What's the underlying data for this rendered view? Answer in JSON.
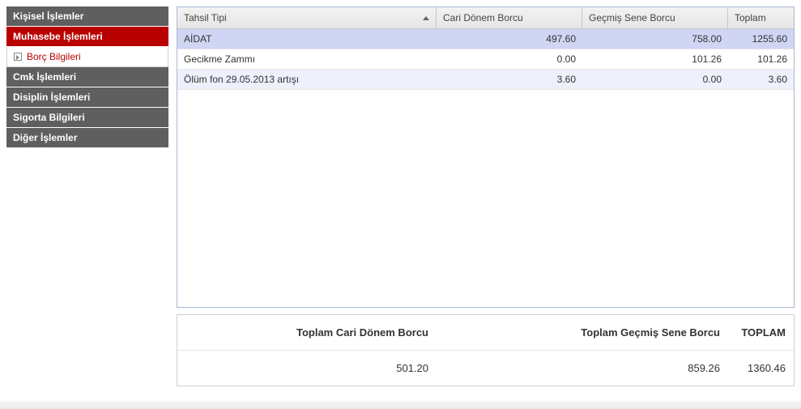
{
  "sidebar": {
    "items": [
      {
        "label": "Kişisel İşlemler",
        "active": false
      },
      {
        "label": "Muhasebe İşlemleri",
        "active": true
      },
      {
        "label": "Cmk İşlemleri",
        "active": false
      },
      {
        "label": "Disiplin İşlemleri",
        "active": false
      },
      {
        "label": "Sigorta Bilgileri",
        "active": false
      },
      {
        "label": "Diğer İşlemler",
        "active": false
      }
    ],
    "subitem": {
      "label": "Borç Bilgileri"
    }
  },
  "grid": {
    "headers": {
      "type": "Tahsil Tipi",
      "cari": "Cari Dönem Borcu",
      "gecmis": "Geçmiş Sene Borcu",
      "toplam": "Toplam"
    },
    "rows": [
      {
        "type": "AİDAT",
        "cari": "497.60",
        "gecmis": "758.00",
        "toplam": "1255.60",
        "selected": true
      },
      {
        "type": "Gecikme Zammı",
        "cari": "0.00",
        "gecmis": "101.26",
        "toplam": "101.26",
        "selected": false
      },
      {
        "type": "Ölüm fon 29.05.2013 artışı",
        "cari": "3.60",
        "gecmis": "0.00",
        "toplam": "3.60",
        "selected": false
      }
    ]
  },
  "summary": {
    "labels": {
      "cari": "Toplam Cari Dönem Borcu",
      "gecmis": "Toplam Geçmiş Sene Borcu",
      "toplam": "TOPLAM"
    },
    "values": {
      "cari": "501.20",
      "gecmis": "859.26",
      "toplam": "1360.46"
    }
  }
}
